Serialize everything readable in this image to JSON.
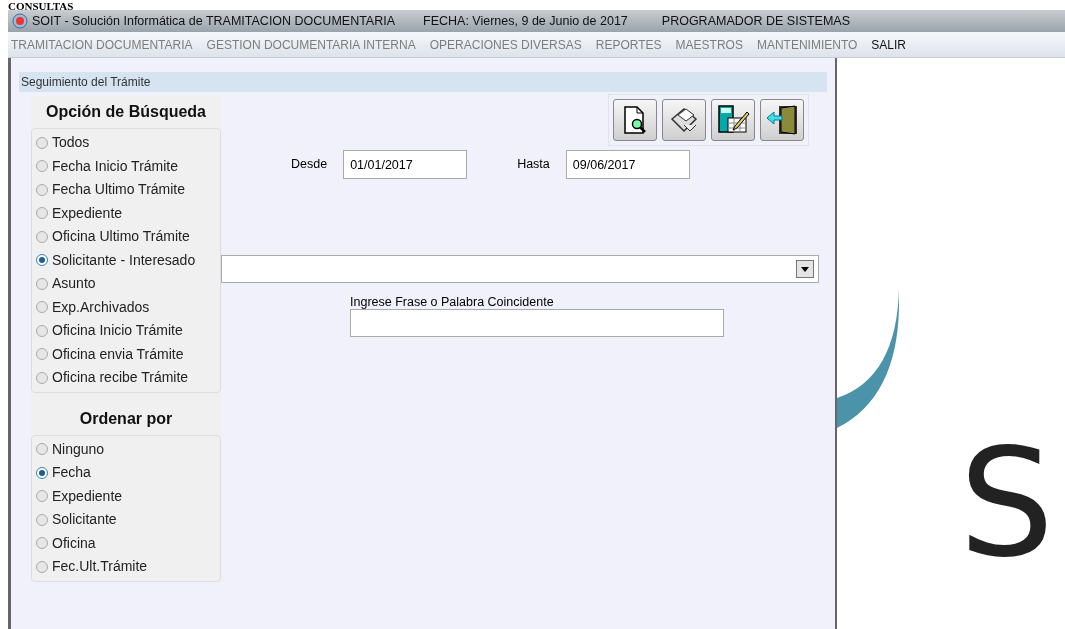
{
  "page_heading": "CONSULTAS",
  "window": {
    "title": "SOIT - Solución Informática de TRAMITACION DOCUMENTARIA",
    "date": "FECHA: Viernes,  9 de Junio de 2017",
    "user": "PROGRAMADOR DE SISTEMAS"
  },
  "menu": [
    {
      "label": "TRAMITACION DOCUMENTARIA",
      "disabled": true
    },
    {
      "label": "GESTION DOCUMENTARIA INTERNA",
      "disabled": true
    },
    {
      "label": "OPERACIONES DIVERSAS",
      "disabled": true
    },
    {
      "label": "REPORTES",
      "disabled": true
    },
    {
      "label": "MAESTROS",
      "disabled": true
    },
    {
      "label": "MANTENIMIENTO",
      "disabled": true
    },
    {
      "label": "SALIR",
      "disabled": false
    }
  ],
  "panel": {
    "title": "Seguimiento del Trámite"
  },
  "search_options": {
    "title": "Opción de Búsqueda",
    "items": [
      {
        "label": "Todos",
        "selected": false
      },
      {
        "label": "Fecha Inicio Trámite",
        "selected": false
      },
      {
        "label": "Fecha Ultimo Trámite",
        "selected": false
      },
      {
        "label": "Expediente",
        "selected": false
      },
      {
        "label": "Oficina Ultimo Trámite",
        "selected": false
      },
      {
        "label": "Solicitante - Interesado",
        "selected": true
      },
      {
        "label": "Asunto",
        "selected": false
      },
      {
        "label": "Exp.Archivados",
        "selected": false
      },
      {
        "label": "Oficina Inicio Trámite",
        "selected": false
      },
      {
        "label": "Oficina envia Trámite",
        "selected": false
      },
      {
        "label": "Oficina recibe Trámite",
        "selected": false
      }
    ]
  },
  "sort_options": {
    "title": "Ordenar por",
    "items": [
      {
        "label": "Ninguno",
        "selected": false
      },
      {
        "label": "Fecha",
        "selected": true
      },
      {
        "label": "Expediente",
        "selected": false
      },
      {
        "label": "Solicitante",
        "selected": false
      },
      {
        "label": "Oficina",
        "selected": false
      },
      {
        "label": "Fec.Ult.Trámite",
        "selected": false
      }
    ]
  },
  "toolbar": [
    {
      "kind": "preview"
    },
    {
      "kind": "print"
    },
    {
      "kind": "calculator"
    },
    {
      "kind": "exit"
    }
  ],
  "date_from": {
    "label": "Desde",
    "value": "01/01/2017"
  },
  "date_to": {
    "label": "Hasta",
    "value": "09/06/2017"
  },
  "phrase": {
    "label": "Ingrese Frase o Palabra Coincidente"
  },
  "logo": {
    "letter": "S"
  }
}
